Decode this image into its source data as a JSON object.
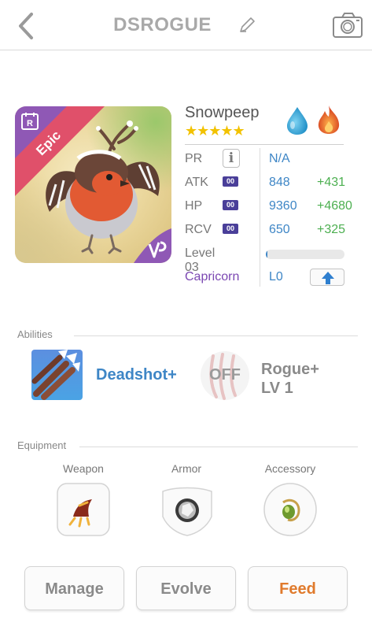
{
  "header": {
    "title": "DSROGUE",
    "back_icon": "chevron-left-icon",
    "edit_icon": "pencil-icon",
    "camera_icon": "camera-icon"
  },
  "monster": {
    "name": "Snowpeep",
    "rarity": "Epic",
    "rarity_badge": "R",
    "stars": "★★★★★",
    "star_count": 5,
    "elements": [
      "water",
      "fire"
    ],
    "stats": {
      "pr": {
        "label": "PR",
        "value": "N/A",
        "info_icon": "i"
      },
      "atk": {
        "label": "ATK",
        "plus": "00",
        "value": "848",
        "bonus": "+431"
      },
      "hp": {
        "label": "HP",
        "plus": "00",
        "value": "9360",
        "bonus": "+4680"
      },
      "rcv": {
        "label": "RCV",
        "plus": "00",
        "value": "650",
        "bonus": "+325"
      }
    },
    "level": {
      "label": "Level 03",
      "progress": 0.02
    },
    "sign": {
      "label": "Capricorn",
      "value": "L0"
    }
  },
  "abilities": {
    "title": "Abilities",
    "items": [
      {
        "name": "Deadshot+",
        "icon": "arrows-icon"
      },
      {
        "status": "OFF",
        "name_line1": "Rogue+",
        "name_line2": "LV 1",
        "icon": "claw-icon"
      }
    ]
  },
  "equipment": {
    "title": "Equipment",
    "slots": [
      {
        "label": "Weapon",
        "icon": "claw-weapon-icon"
      },
      {
        "label": "Armor",
        "icon": "crystal-armor-icon"
      },
      {
        "label": "Accessory",
        "icon": "gem-accessory-icon"
      }
    ]
  },
  "actions": {
    "manage": "Manage",
    "evolve": "Evolve",
    "feed": "Feed"
  },
  "colors": {
    "accent_blue": "#3e86c6",
    "bonus_green": "#4caf50",
    "purple": "#7b47b2",
    "feed_orange": "#e07a2c",
    "epic_red": "#e0506a"
  }
}
